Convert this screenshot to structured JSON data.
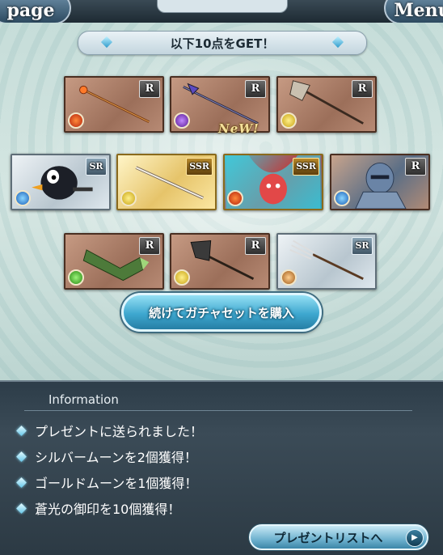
{
  "header": {
    "left_button": "page",
    "right_button": "Menu"
  },
  "banner": {
    "text": "以下10点をGET！"
  },
  "new_label": "NeW!",
  "items": [
    {
      "rarity": "R",
      "element": "fire",
      "kind": "staff"
    },
    {
      "rarity": "R",
      "element": "dark",
      "kind": "spear"
    },
    {
      "rarity": "R",
      "element": "light",
      "kind": "axe"
    },
    {
      "rarity": "SR",
      "element": "water",
      "kind": "character"
    },
    {
      "rarity": "SSR",
      "element": "light",
      "kind": "sword"
    },
    {
      "rarity": "SSR",
      "element": "fire",
      "kind": "character"
    },
    {
      "rarity": "R",
      "element": "water",
      "kind": "character"
    },
    {
      "rarity": "R",
      "element": "wind",
      "kind": "gauntlet"
    },
    {
      "rarity": "R",
      "element": "light",
      "kind": "axe"
    },
    {
      "rarity": "SR",
      "element": "earth",
      "kind": "fork"
    }
  ],
  "buy_button": "続けてガチャセットを購入",
  "info": {
    "heading": "Information",
    "messages": [
      "プレゼントに送られました！",
      "シルバームーンを2個獲得！",
      "ゴールドムーンを1個獲得！",
      "蒼光の御印を10個獲得！"
    ]
  },
  "present_list_button": "プレゼントリストへ"
}
